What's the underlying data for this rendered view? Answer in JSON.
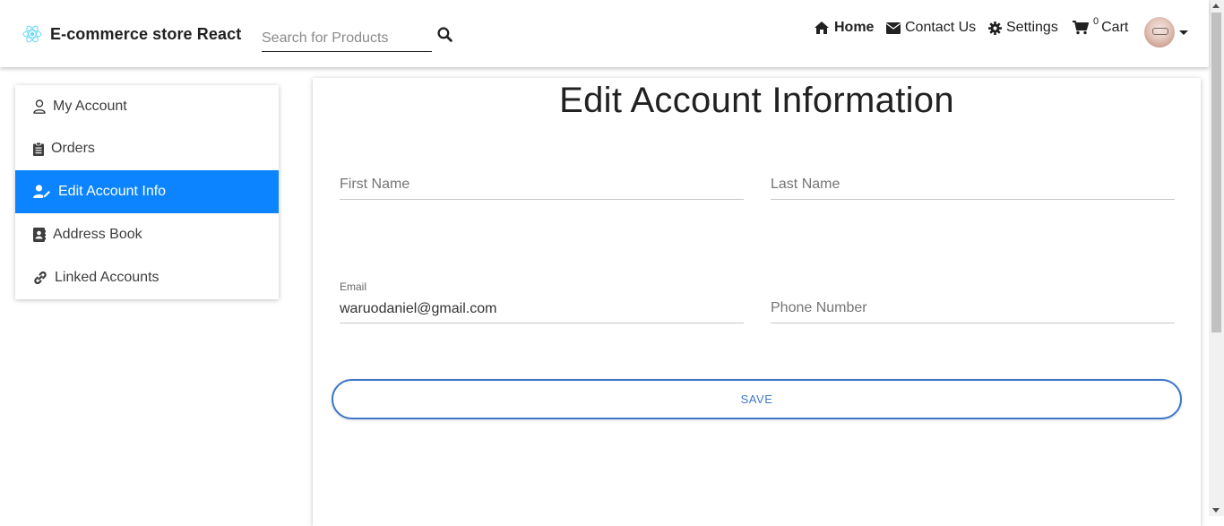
{
  "header": {
    "brand": "E-commerce store React",
    "search_placeholder": "Search for Products",
    "nav": {
      "home": "Home",
      "contact": "Contact Us",
      "settings": "Settings",
      "cart_count": "0",
      "cart": "Cart"
    }
  },
  "sidebar": {
    "items": [
      {
        "label": "My Account",
        "icon": "user-icon"
      },
      {
        "label": "Orders",
        "icon": "clipboard-icon"
      },
      {
        "label": "Edit Account Info",
        "icon": "user-edit-icon"
      },
      {
        "label": "Address Book",
        "icon": "address-book-icon"
      },
      {
        "label": "Linked Accounts",
        "icon": "link-icon"
      }
    ],
    "active_index": 2
  },
  "form": {
    "title": "Edit Account Information",
    "first_name_placeholder": "First Name",
    "last_name_placeholder": "Last Name",
    "email_label": "Email",
    "email_value": "waruodaniel@gmail.com",
    "phone_placeholder": "Phone Number",
    "save_label": "SAVE"
  },
  "colors": {
    "accent": "#0d84ff",
    "button_border": "#3f78c9"
  }
}
